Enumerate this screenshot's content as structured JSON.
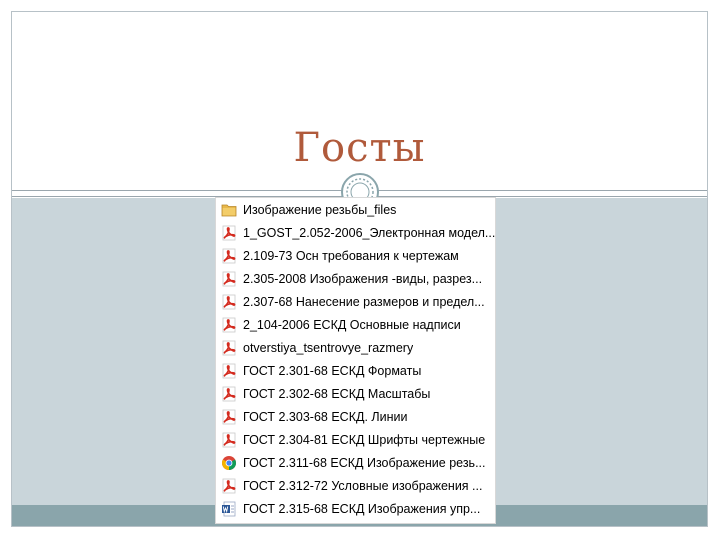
{
  "slide": {
    "title": "Госты"
  },
  "colors": {
    "title": "#b05a3b",
    "content_bg": "#c9d5da",
    "bottom_band": "#8aa5ab",
    "frame": "#b7c1c7",
    "pdf_red": "#d42a1e",
    "folder": "#e8b84a",
    "word_blue": "#2b5797"
  },
  "files": [
    {
      "name": "Изображение резьбы_files",
      "icon": "folder-icon"
    },
    {
      "name": "1_GOST_2.052-2006_Электронная модел...",
      "icon": "pdf-icon"
    },
    {
      "name": "2.109-73 Осн требования к чертежам",
      "icon": "pdf-icon"
    },
    {
      "name": "2.305-2008 Изображения -виды, разрез...",
      "icon": "pdf-icon"
    },
    {
      "name": "2.307-68 Нанесение размеров и предел...",
      "icon": "pdf-icon"
    },
    {
      "name": "2_104-2006 ЕСКД Основные надписи",
      "icon": "pdf-icon"
    },
    {
      "name": "otverstiya_tsentrovye_razmery",
      "icon": "pdf-icon"
    },
    {
      "name": "ГОСТ 2.301-68 ЕСКД Форматы",
      "icon": "pdf-icon"
    },
    {
      "name": "ГОСТ 2.302-68 ЕСКД Масштабы",
      "icon": "pdf-icon"
    },
    {
      "name": "ГОСТ 2.303-68 ЕСКД. Линии",
      "icon": "pdf-icon"
    },
    {
      "name": "ГОСТ 2.304-81 ЕСКД Шрифты чертежные",
      "icon": "pdf-icon"
    },
    {
      "name": "ГОСТ 2.311-68 ЕСКД Изображение резь...",
      "icon": "chrome-icon"
    },
    {
      "name": "ГОСТ 2.312-72 Условные изображения ...",
      "icon": "pdf-icon"
    },
    {
      "name": "ГОСТ 2.315-68 ЕСКД Изображения упр...",
      "icon": "word-document-icon"
    }
  ]
}
